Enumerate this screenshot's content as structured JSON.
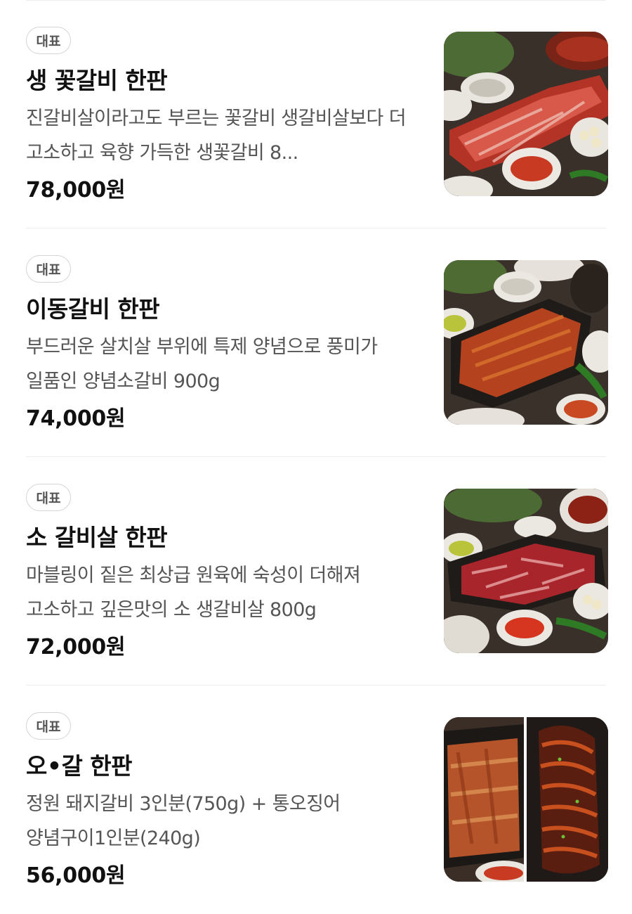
{
  "menu": {
    "items": [
      {
        "badge": "대표",
        "title": "생 꽃갈비 한판",
        "description": "진갈비살이라고도 부르는 꽃갈비 생갈비살보다 더 고소하고 육향 가득한 생꽃갈비 8...",
        "price": "78,000원",
        "image_icon": "raw-rib-platter-photo"
      },
      {
        "badge": "대표",
        "title": "이동갈비 한판",
        "description": "부드러운 살치살 부위에 특제 양념으로 풍미가 일품인 양념소갈비 900g",
        "price": "74,000원",
        "image_icon": "marinated-rib-platter-photo"
      },
      {
        "badge": "대표",
        "title": "소 갈비살 한판",
        "description": "마블링이 짙은 최상급 원육에 숙성이 더해져 고소하고 깊은맛의 소 생갈비살 800g",
        "price": "72,000원",
        "image_icon": "beef-rib-meat-platter-photo"
      },
      {
        "badge": "대표",
        "title": "오•갈 한판",
        "description": "정원 돼지갈비 3인분(750g) + 통오징어 양념구이1인분(240g)",
        "price": "56,000원",
        "image_icon": "pork-rib-and-squid-photo"
      }
    ]
  }
}
